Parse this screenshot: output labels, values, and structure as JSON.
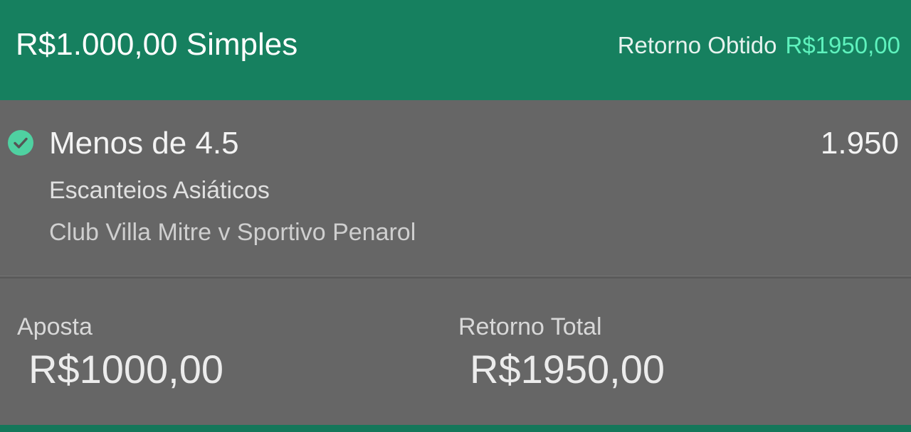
{
  "header": {
    "title": "R$1.000,00 Simples",
    "return_label": "Retorno Obtido",
    "return_value": "R$1950,00"
  },
  "selection": {
    "status_icon": "check-circle-icon",
    "name": "Menos de 4.5",
    "odds": "1.950",
    "market": "Escanteios Asiáticos",
    "event": "Club Villa Mitre v Sportivo Penarol"
  },
  "summary": {
    "stake_label": "Aposta",
    "stake_value": "R$1000,00",
    "total_label": "Retorno Total",
    "total_value": "R$1950,00"
  },
  "colors": {
    "header_bg": "#16805F",
    "return_value": "#5EF2BD",
    "check_icon": "#4FD1A1",
    "body_bg": "#666666"
  }
}
